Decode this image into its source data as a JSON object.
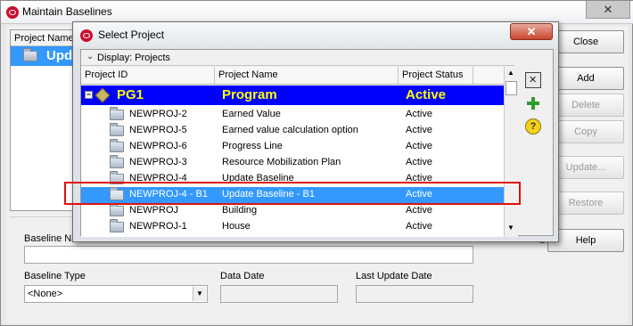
{
  "outer_window": {
    "title": "Maintain Baselines",
    "close_glyph": "✕",
    "list": {
      "column_header": "Project Name/",
      "row_text": "Upda"
    },
    "buttons": {
      "close": "Close",
      "add": "Add",
      "delete": "Delete",
      "copy": "Copy",
      "update": "Update...",
      "restore": "Restore",
      "help": "Help"
    },
    "form": {
      "baseline_name_label": "Baseline Na",
      "baseline_name_value": "",
      "baseline_type_label": "Baseline Type",
      "baseline_type_value": "<None>",
      "data_date_label": "Data Date",
      "data_date_value": "",
      "last_update_date_label": "Last Update Date",
      "last_update_date_value": ""
    }
  },
  "dialog": {
    "title": "Select Project",
    "close_glyph": "✕",
    "display_label": "Display: Projects",
    "columns": [
      "Project ID",
      "Project Name",
      "Project Status"
    ],
    "wbs_row": {
      "id": "PG1",
      "name": "Program",
      "status": "Active"
    },
    "rows": [
      {
        "id": "NEWPROJ-2",
        "name": "Earned Value",
        "status": "Active"
      },
      {
        "id": "NEWPROJ-5",
        "name": "Earned value calculation option",
        "status": "Active"
      },
      {
        "id": "NEWPROJ-6",
        "name": "Progress Line",
        "status": "Active"
      },
      {
        "id": "NEWPROJ-3",
        "name": "Resource Mobilization Plan",
        "status": "Active"
      },
      {
        "id": "NEWPROJ-4",
        "name": "Update Baseline",
        "status": "Active"
      },
      {
        "id": "NEWPROJ-4 - B1",
        "name": "Update Baseline - B1",
        "status": "Active"
      },
      {
        "id": "NEWPROJ",
        "name": "Building",
        "status": "Active"
      },
      {
        "id": "NEWPROJ-1",
        "name": "House",
        "status": "Active"
      }
    ],
    "selected_row_index": 5
  },
  "colors": {
    "selection": "#3399ff",
    "wbs_band": "#0000ff",
    "wbs_text": "#ffff00",
    "highlight_outline": "#e01010",
    "dialog_close": "#c9452f"
  }
}
